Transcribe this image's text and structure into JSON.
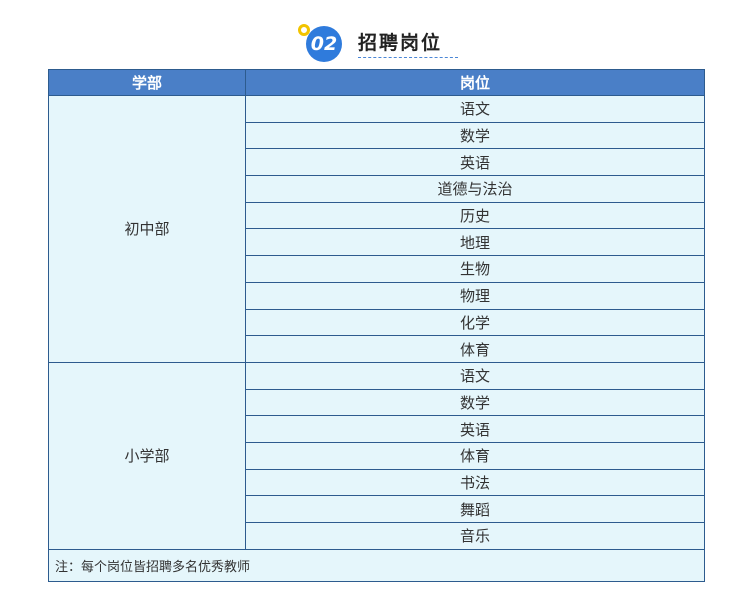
{
  "header": {
    "badge": "02",
    "title": "招聘岗位"
  },
  "table": {
    "columns": [
      "学部",
      "岗位"
    ],
    "departments": [
      {
        "name": "初中部",
        "positions": [
          "语文",
          "数学",
          "英语",
          "道德与法治",
          "历史",
          "地理",
          "生物",
          "物理",
          "化学",
          "体育"
        ]
      },
      {
        "name": "小学部",
        "positions": [
          "语文",
          "数学",
          "英语",
          "体育",
          "书法",
          "舞蹈",
          "音乐"
        ]
      }
    ],
    "note": "注：每个岗位皆招聘多名优秀教师"
  },
  "colors": {
    "header_bg": "#4a7fc7",
    "cell_bg": "#e5f6fb",
    "border": "#2d5b8e",
    "badge_blue": "#2f7bdc",
    "badge_ring": "#f2c400"
  }
}
